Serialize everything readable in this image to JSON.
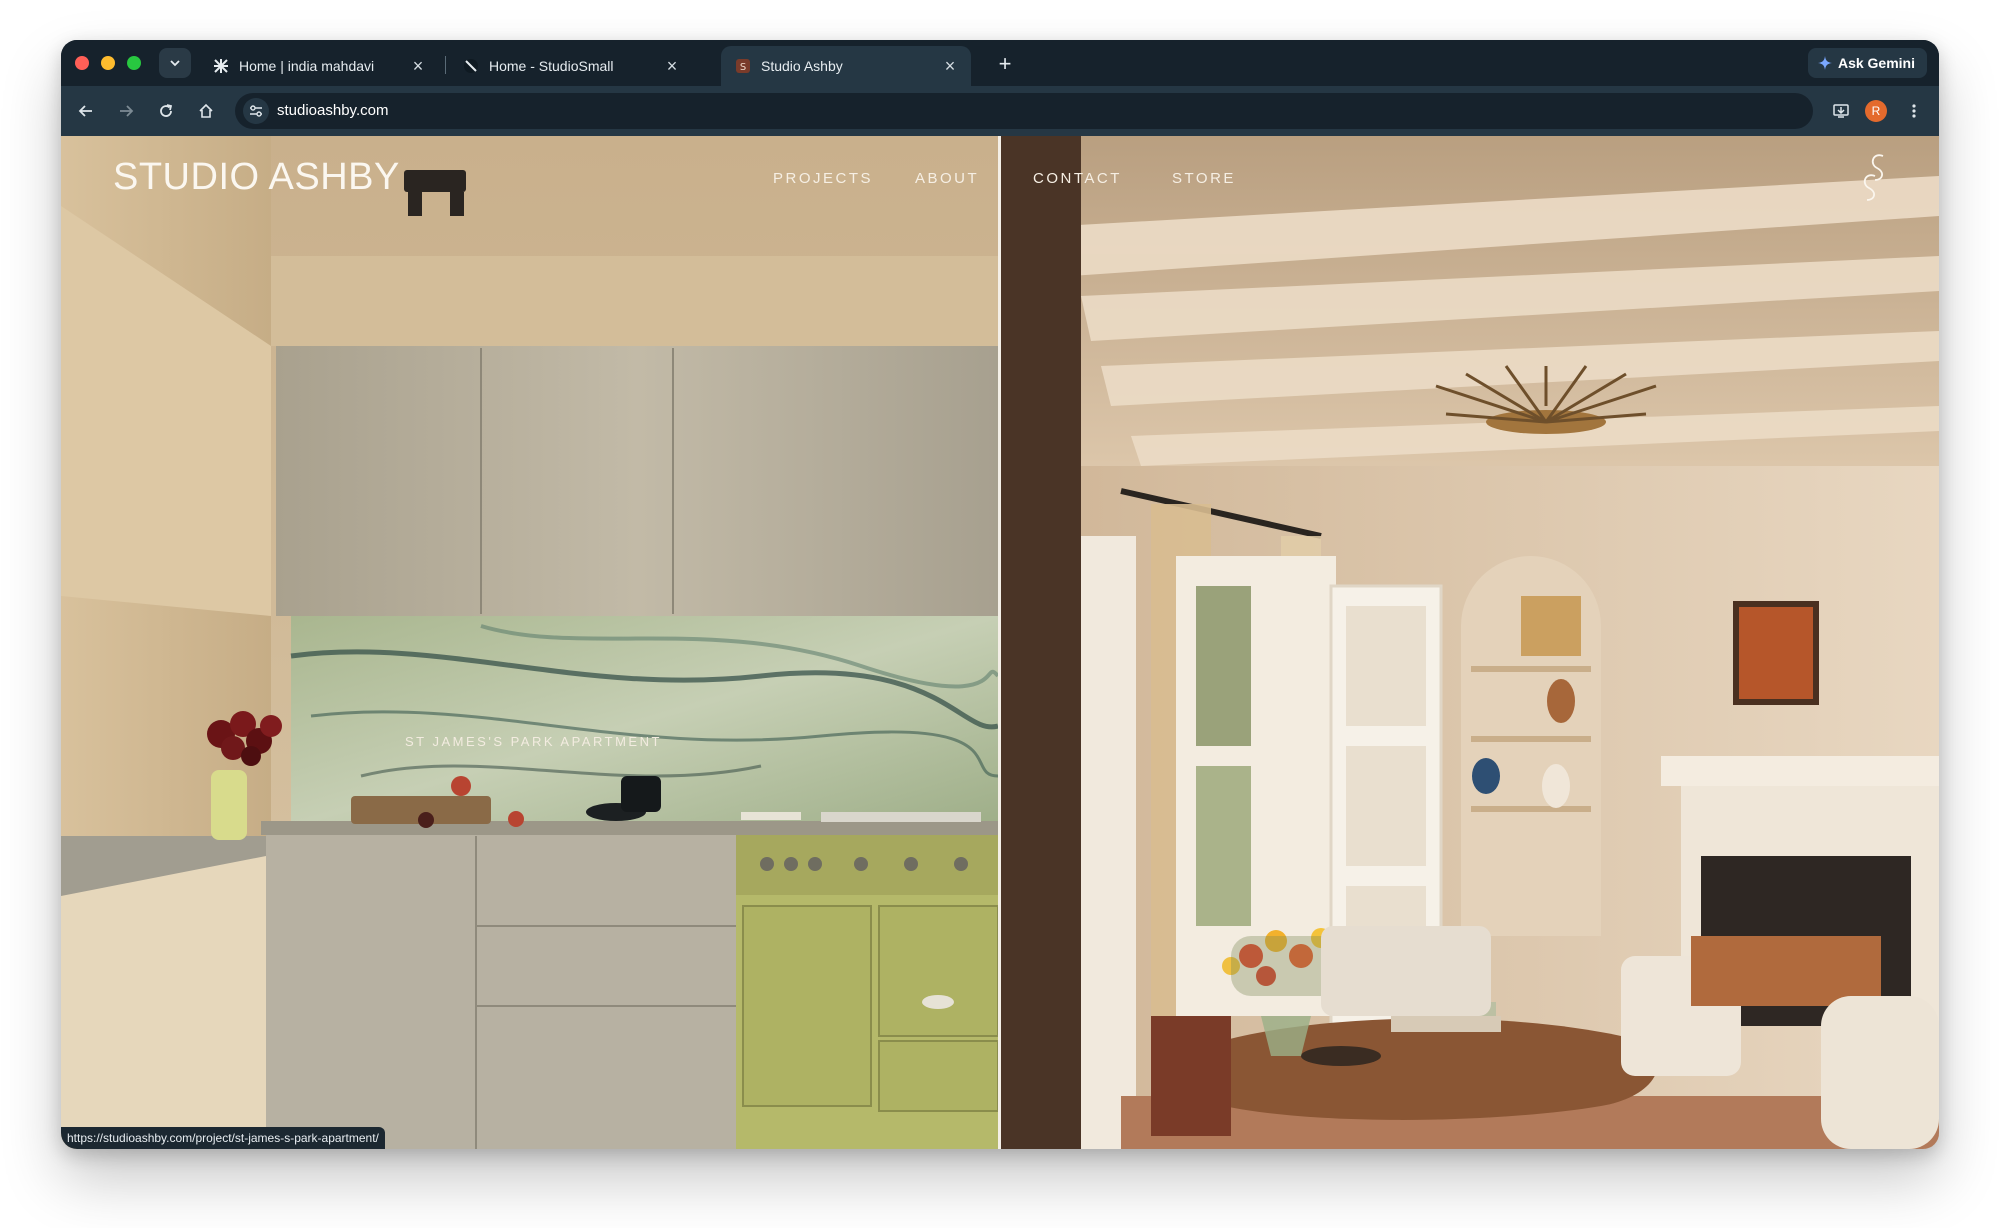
{
  "browser": {
    "tabs": [
      {
        "title": "Home | india mahdavi",
        "active": false
      },
      {
        "title": "Home - StudioSmall",
        "active": false
      },
      {
        "title": "Studio Ashby",
        "active": true
      }
    ],
    "ask_gemini": "Ask Gemini",
    "url": "studioashby.com",
    "avatar_initial": "R",
    "status_url": "https://studioashby.com/project/st-james-s-park-apartment/"
  },
  "site": {
    "brand": "STUDIO ASHBY",
    "nav": [
      "PROJECTS",
      "ABOUT",
      "CONTACT",
      "STORE"
    ],
    "project_hover_label": "ST JAMES'S PARK APARTMENT"
  },
  "colors": {
    "tabstrip": "#16222c",
    "toolbar": "#253744",
    "avatar": "#e46a2d"
  }
}
